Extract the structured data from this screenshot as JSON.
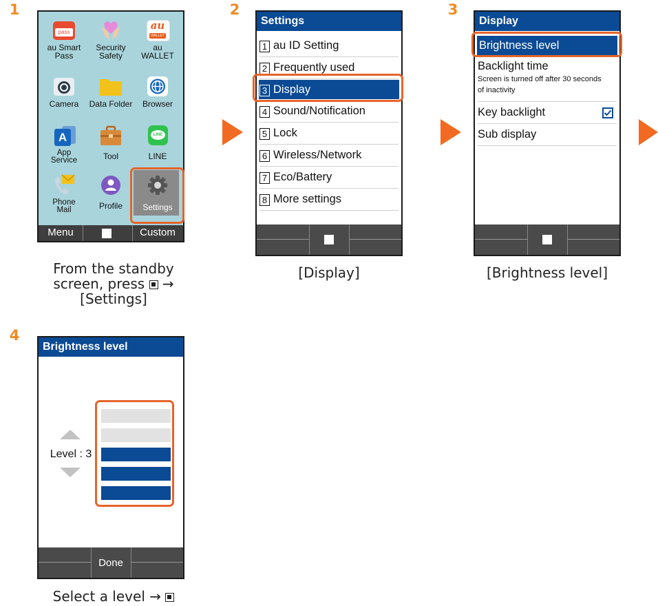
{
  "steps": [
    "1",
    "2",
    "3",
    "4"
  ],
  "step1": {
    "apps": [
      {
        "name": "au Smart\nPass",
        "icon": "au-smart-pass-icon"
      },
      {
        "name": "Security\nSafety",
        "icon": "security-safety-icon"
      },
      {
        "name": "au\nWALLET",
        "icon": "au-wallet-icon"
      },
      {
        "name": "Camera",
        "icon": "camera-icon"
      },
      {
        "name": "Data Folder",
        "icon": "folder-icon"
      },
      {
        "name": "Browser",
        "icon": "globe-icon"
      },
      {
        "name": "App\nService",
        "icon": "app-service-icon"
      },
      {
        "name": "Tool",
        "icon": "toolbox-icon"
      },
      {
        "name": "LINE",
        "icon": "line-icon"
      },
      {
        "name": "Phone\nMail",
        "icon": "phone-mail-icon"
      },
      {
        "name": "Profile",
        "icon": "profile-icon"
      },
      {
        "name": "Settings",
        "icon": "gear-icon"
      }
    ],
    "pass_text": "pass",
    "au_text": "au",
    "wallet_text": "WALLET",
    "app_service_letter": "A",
    "line_text": "LINE",
    "softkey_left": "Menu",
    "softkey_right": "Custom",
    "caption_line1": "From the standby",
    "caption_line2": "screen, press",
    "caption_line3": "[Settings]"
  },
  "step2": {
    "title": "Settings",
    "items": [
      {
        "num": "1",
        "label": "au ID Setting"
      },
      {
        "num": "2",
        "label": "Frequently used"
      },
      {
        "num": "3",
        "label": "Display"
      },
      {
        "num": "4",
        "label": "Sound/Notification"
      },
      {
        "num": "5",
        "label": "Lock"
      },
      {
        "num": "6",
        "label": "Wireless/Network"
      },
      {
        "num": "7",
        "label": "Eco/Battery"
      },
      {
        "num": "8",
        "label": "More settings"
      }
    ],
    "caption": "[Display]"
  },
  "step3": {
    "title": "Display",
    "items": {
      "brightness": "Brightness level",
      "backlight": "Backlight time",
      "backlight_sub_1": "Screen is turned off after 30 seconds",
      "backlight_sub_2": "of inactivity",
      "key_backlight": "Key backlight",
      "sub_display": "Sub display"
    },
    "key_backlight_checked": true,
    "caption": "[Brightness level]"
  },
  "step4": {
    "title": "Brightness level",
    "level_label": "Level : 3",
    "level": 3,
    "level_max": 5,
    "softkey_center": "Done",
    "caption_text": "Select a level"
  },
  "colors": {
    "title_bar": "#0b4a94",
    "accent": "#e6642a",
    "arrow": "#f26a21",
    "step": "#f08a24"
  },
  "arrow_glyph": "→"
}
